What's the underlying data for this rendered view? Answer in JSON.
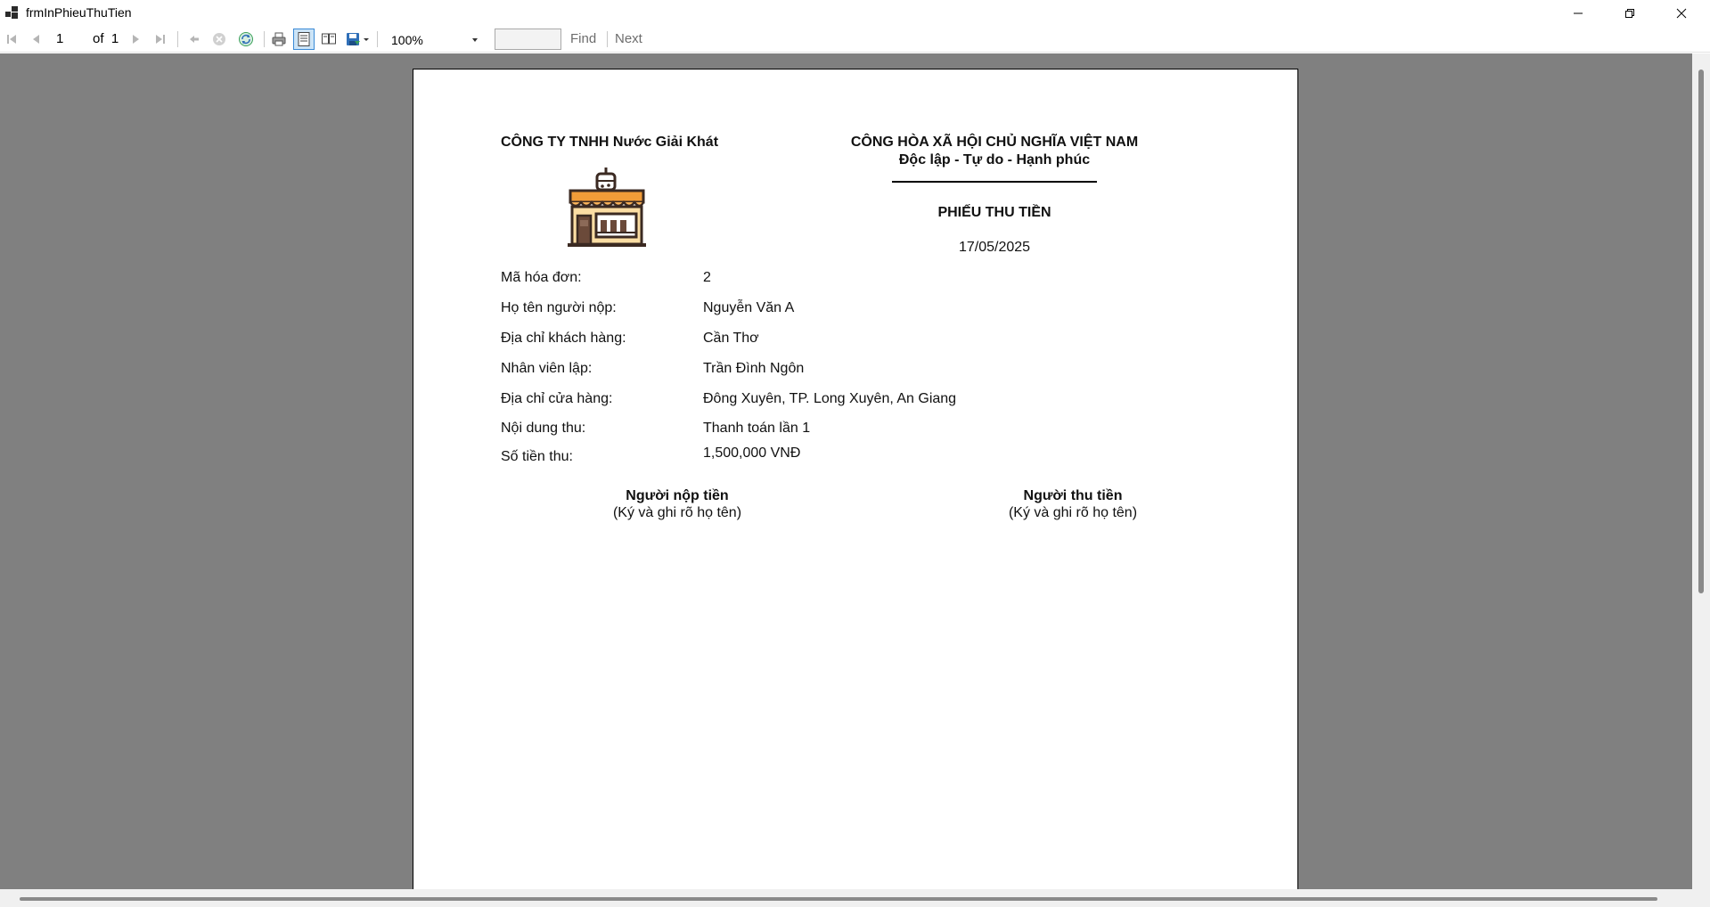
{
  "window": {
    "title": "frmInPhieuThuTien"
  },
  "toolbar": {
    "current_page": "1",
    "of_label": "of",
    "total_pages": "1",
    "zoom": "100%",
    "find_value": "",
    "find_label": "Find",
    "next_label": "Next"
  },
  "report": {
    "company": "CÔNG TY TNHH Nước Giải Khát",
    "nation": "CÔNG HÒA XÃ HỘI CHỦ NGHĨA VIỆT NAM",
    "motto": "Độc lập - Tự do - Hạnh phúc",
    "doc_title": "PHIẾU THU TIỀN",
    "date": "17/05/2025",
    "fields": [
      {
        "label": "Mã hóa đơn:",
        "value": "2"
      },
      {
        "label": "Họ tên người nộp:",
        "value": "Nguyễn Văn A"
      },
      {
        "label": "Địa chỉ khách hàng:",
        "value": "Cần Thơ"
      },
      {
        "label": "Nhân viên lập:",
        "value": "Trần Đình Ngôn"
      },
      {
        "label": "Địa chỉ cửa hàng:",
        "value": "Đông Xuyên, TP. Long Xuyên, An Giang"
      },
      {
        "label": "Nội dung thu:",
        "value": "Thanh toán lần 1"
      },
      {
        "label": "Số tiền thu:",
        "value": "1,500,000 VNĐ"
      }
    ],
    "signer_left_title": "Người nộp tiền",
    "signer_left_note": "(Ký và ghi rõ họ tên)",
    "signer_right_title": "Người thu tiền",
    "signer_right_note": "(Ký và ghi rõ họ tên)"
  },
  "icons": {
    "logo": "shop-storefront-icon"
  },
  "colors": {
    "viewer_background": "#808080",
    "awning_orange": "#F29C38",
    "shop_brown": "#6B4A3A"
  }
}
